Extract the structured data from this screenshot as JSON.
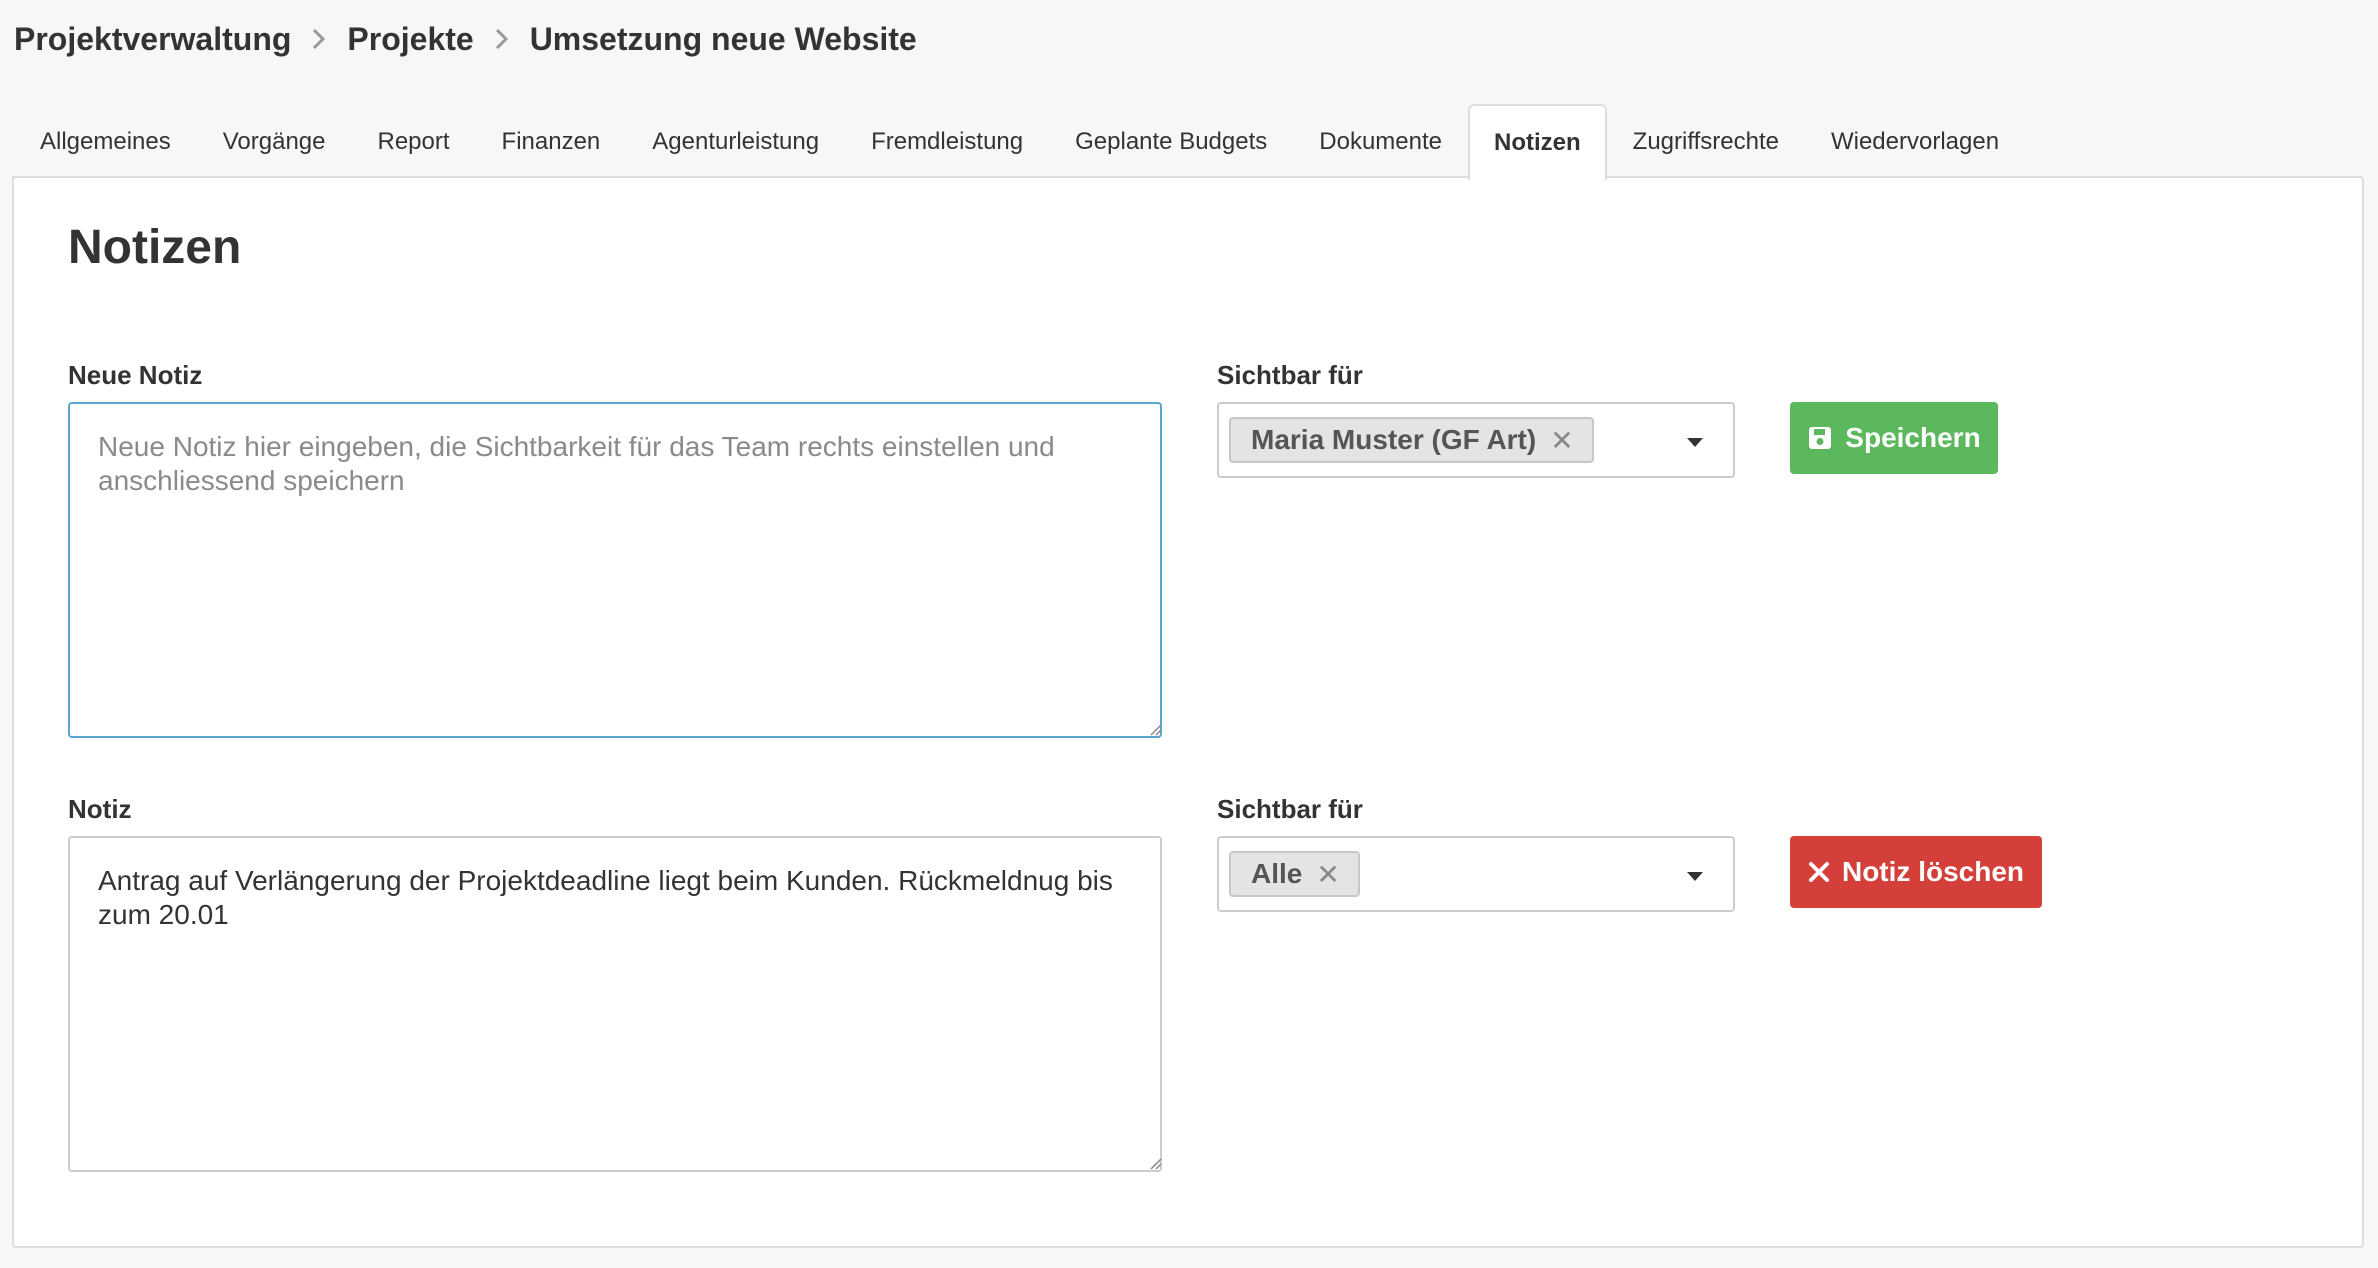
{
  "breadcrumb": {
    "items": [
      "Projektverwaltung",
      "Projekte",
      "Umsetzung neue Website"
    ],
    "separator_icon": "chevron-right-icon"
  },
  "tabs": [
    {
      "label": "Allgemeines",
      "active": false
    },
    {
      "label": "Vorgänge",
      "active": false
    },
    {
      "label": "Report",
      "active": false
    },
    {
      "label": "Finanzen",
      "active": false
    },
    {
      "label": "Agenturleistung",
      "active": false
    },
    {
      "label": "Fremdleistung",
      "active": false
    },
    {
      "label": "Geplante Budgets",
      "active": false
    },
    {
      "label": "Dokumente",
      "active": false
    },
    {
      "label": "Notizen",
      "active": true
    },
    {
      "label": "Zugriffsrechte",
      "active": false
    },
    {
      "label": "Wiedervorlagen",
      "active": false
    }
  ],
  "page": {
    "title": "Notizen"
  },
  "new_note": {
    "label": "Neue Notiz",
    "value": "",
    "placeholder": "Neue Notiz hier eingeben, die Sichtbarkeit für das Team rechts einstellen und anschliessend speichern",
    "visibility_label": "Sichtbar für",
    "visibility_chip": "Maria Muster (GF Art)",
    "chip_remove_icon": "close-icon",
    "save_button": "Speichern",
    "save_icon": "floppy-disk-icon"
  },
  "note": {
    "label": "Notiz",
    "value": "Antrag auf Verlängerung der Projektdeadline liegt beim Kunden. Rückmeldnug bis zum 20.01",
    "visibility_label": "Sichtbar für",
    "visibility_chip": "Alle",
    "chip_remove_icon": "close-icon",
    "delete_button": "Notiz löschen",
    "delete_icon": "close-icon"
  },
  "colors": {
    "save_button": "#5cb85c",
    "delete_button": "#d43f3a",
    "focus_border": "#5aa6d0"
  }
}
